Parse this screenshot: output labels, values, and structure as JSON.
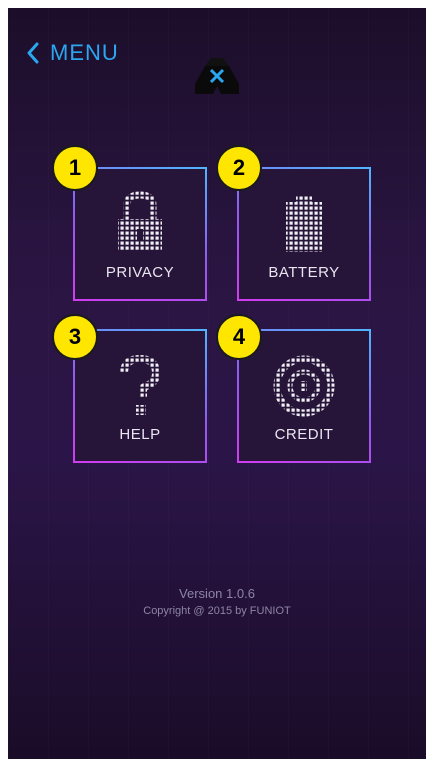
{
  "header": {
    "back_label": "MENU"
  },
  "tiles": [
    {
      "number": "1",
      "label": "PRIVACY",
      "icon": "lock-icon"
    },
    {
      "number": "2",
      "label": "BATTERY",
      "icon": "battery-icon"
    },
    {
      "number": "3",
      "label": "HELP",
      "icon": "question-mark-icon"
    },
    {
      "number": "4",
      "label": "CREDIT",
      "icon": "coin-icon"
    }
  ],
  "footer": {
    "version": "Version 1.0.6",
    "copyright": "Copyright @ 2015 by FUNIOT"
  },
  "colors": {
    "accent": "#2aa7f0",
    "badge": "#ffe600",
    "tile_border_top": "#4fb6ff",
    "tile_border_bottom": "#d13cf0"
  }
}
